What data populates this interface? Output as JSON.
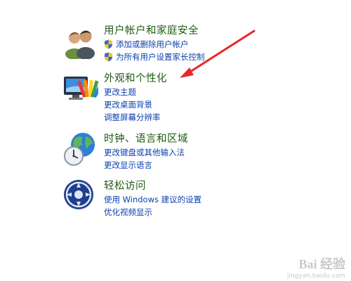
{
  "categories": [
    {
      "title": "用户帐户和家庭安全",
      "icon": "users-icon",
      "links": [
        {
          "label": "添加或删除用户帐户",
          "shield": true
        },
        {
          "label": "为所有用户设置家长控制",
          "shield": true
        }
      ]
    },
    {
      "title": "外观和个性化",
      "icon": "appearance-icon",
      "links": [
        {
          "label": "更改主题"
        },
        {
          "label": "更改桌面背景"
        },
        {
          "label": "调整屏幕分辨率"
        }
      ]
    },
    {
      "title": "时钟、语言和区域",
      "icon": "clock-globe-icon",
      "links": [
        {
          "label": "更改键盘或其他输入法"
        },
        {
          "label": "更改显示语言"
        }
      ]
    },
    {
      "title": "轻松访问",
      "icon": "ease-of-access-icon",
      "links": [
        {
          "label": "使用 Windows 建议的设置"
        },
        {
          "label": "优化视频显示"
        }
      ]
    }
  ],
  "annotation": {
    "color": "#e8262a",
    "icon": "red-arrow-annotation"
  },
  "watermark": {
    "main": "Bai 经验",
    "sub": "jingyan.baidu.com"
  },
  "colors": {
    "title": "#1e5a0f",
    "link": "#0b3fb0"
  }
}
